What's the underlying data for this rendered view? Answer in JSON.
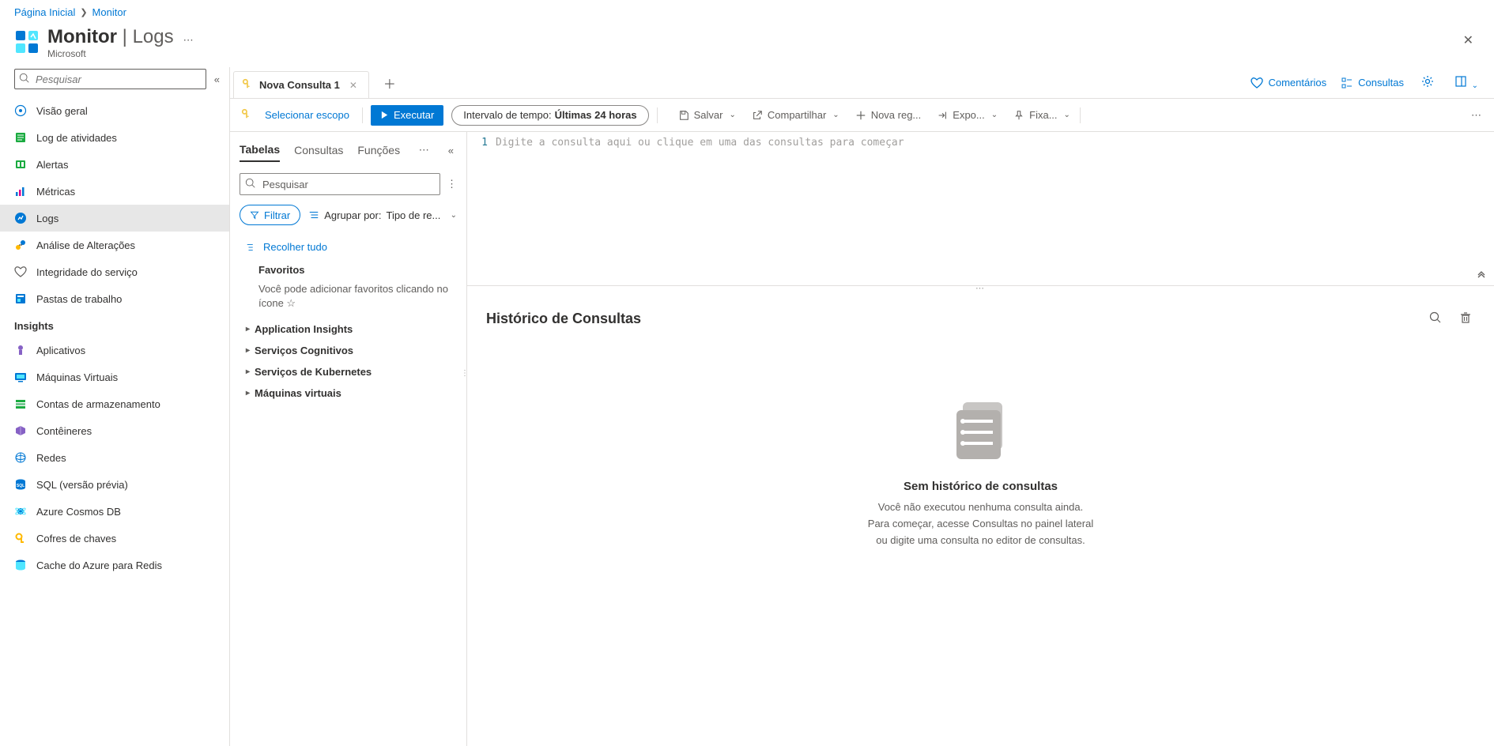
{
  "breadcrumb": {
    "home": "Página Inicial",
    "current": "Monitor"
  },
  "header": {
    "title": "Monitor",
    "section": "Logs",
    "subtitle": "Microsoft"
  },
  "sidebar": {
    "search_placeholder": "Pesquisar",
    "items": [
      {
        "label": "Visão geral",
        "icon": "overview"
      },
      {
        "label": "Log de atividades",
        "icon": "activity"
      },
      {
        "label": "Alertas",
        "icon": "alerts"
      },
      {
        "label": "Métricas",
        "icon": "metrics"
      },
      {
        "label": "Logs",
        "icon": "logs",
        "selected": true
      },
      {
        "label": "Análise de Alterações",
        "icon": "changes"
      },
      {
        "label": "Integridade do serviço",
        "icon": "health"
      },
      {
        "label": "Pastas de trabalho",
        "icon": "workbooks"
      }
    ],
    "section_insights": "Insights",
    "insights": [
      {
        "label": "Aplicativos",
        "icon": "apps"
      },
      {
        "label": "Máquinas Virtuais",
        "icon": "vms"
      },
      {
        "label": "Contas de armazenamento",
        "icon": "storage"
      },
      {
        "label": "Contêineres",
        "icon": "containers"
      },
      {
        "label": "Redes",
        "icon": "networks"
      },
      {
        "label": "SQL (versão prévia)",
        "icon": "sql"
      },
      {
        "label": "Azure Cosmos DB",
        "icon": "cosmos"
      },
      {
        "label": "Cofres de chaves",
        "icon": "keyvault"
      },
      {
        "label": "Cache do Azure para Redis",
        "icon": "redis"
      }
    ]
  },
  "tabs": {
    "items": [
      {
        "title": "Nova Consulta 1"
      }
    ]
  },
  "top_actions": {
    "feedback": "Comentários",
    "queries": "Consultas"
  },
  "toolbar": {
    "scope": "Selecionar escopo",
    "run": "Executar",
    "time_label": "Intervalo de tempo:",
    "time_value": "Últimas 24 horas",
    "save": "Salvar",
    "share": "Compartilhar",
    "new_rule": "Nova reg...",
    "export": "Expo...",
    "pin": "Fixa..."
  },
  "schema": {
    "tabs": {
      "tables": "Tabelas",
      "queries": "Consultas",
      "functions": "Funções"
    },
    "search_placeholder": "Pesquisar",
    "filter": "Filtrar",
    "group_by_label": "Agrupar por:",
    "group_by_value": "Tipo de re...",
    "collapse_all": "Recolher tudo",
    "favorites": "Favoritos",
    "favorites_hint": "Você pode adicionar favoritos clicando no ícone ☆",
    "categories": [
      "Application Insights",
      "Serviços Cognitivos",
      "Serviços de Kubernetes",
      "Máquinas virtuais"
    ]
  },
  "editor": {
    "line_number": "1",
    "placeholder": "Digite a consulta aqui ou clique em uma das consultas para começar"
  },
  "results": {
    "title": "Histórico de Consultas",
    "empty_title": "Sem histórico de consultas",
    "empty_line1": "Você não executou nenhuma consulta ainda.",
    "empty_line2": "Para começar, acesse Consultas no painel lateral",
    "empty_line3": "ou digite uma consulta no editor de consultas."
  }
}
